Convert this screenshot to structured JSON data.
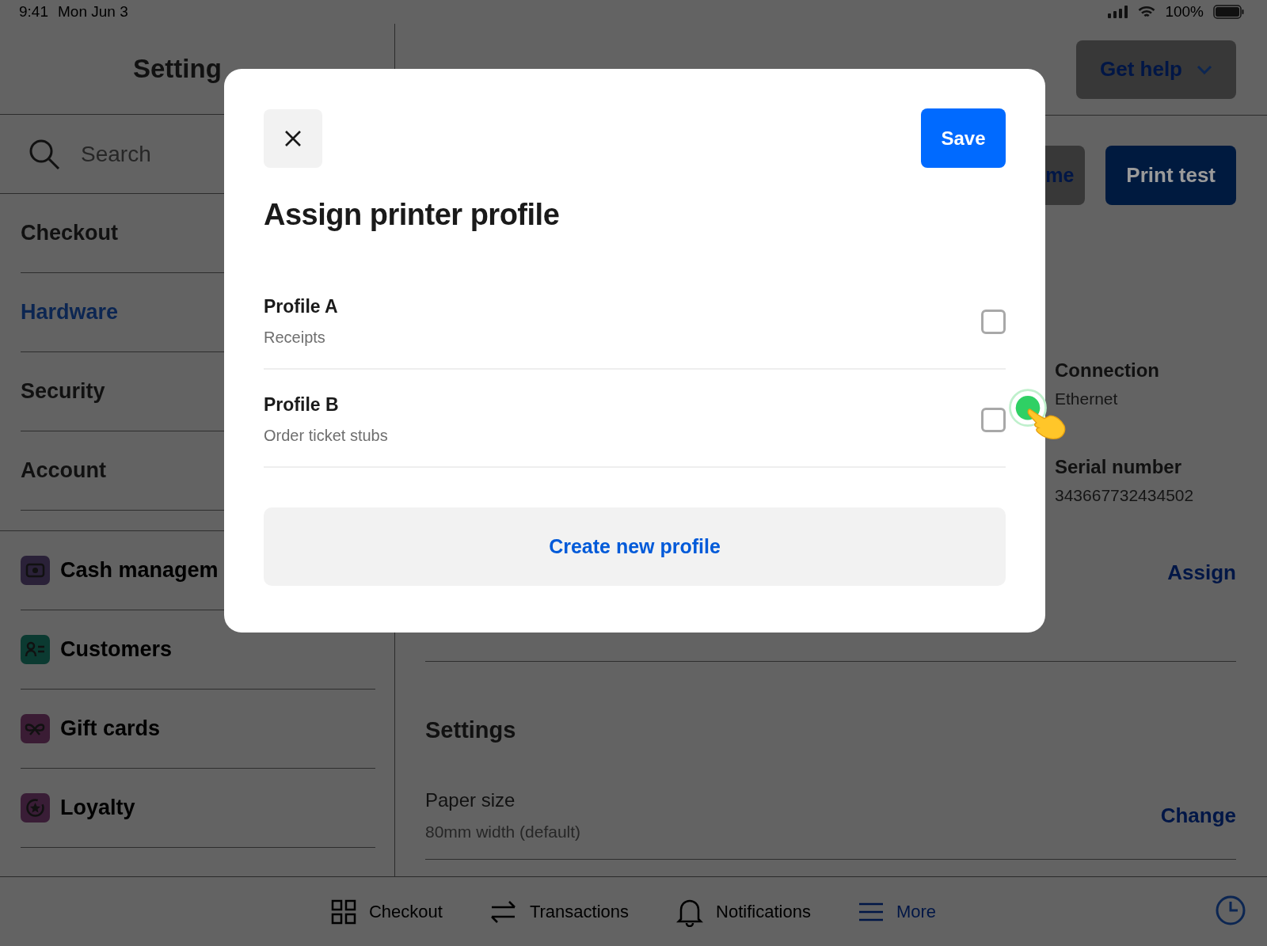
{
  "status_bar": {
    "time": "9:41",
    "date": "Mon Jun 3",
    "battery": "100%"
  },
  "sidebar": {
    "title": "Setting",
    "search": {
      "placeholder": "Search"
    },
    "sections": [
      {
        "label": "Checkout",
        "selected": false
      },
      {
        "label": "Hardware",
        "selected": true
      },
      {
        "label": "Security",
        "selected": false
      },
      {
        "label": "Account",
        "selected": false
      }
    ],
    "apps": [
      {
        "label": "Cash managem",
        "kind": "cash",
        "color": "#2a2138"
      },
      {
        "label": "Customers",
        "kind": "customers",
        "color": "#0b3a31"
      },
      {
        "label": "Gift cards",
        "kind": "gift",
        "color": "#3a1c34"
      },
      {
        "label": "Loyalty",
        "kind": "loyalty",
        "color": "#391d36"
      }
    ]
  },
  "content": {
    "help_button": "Get help",
    "buttons": [
      "me",
      "Print test"
    ],
    "details": [
      {
        "label": "Connection",
        "value": "Ethernet"
      },
      {
        "label": "Serial number",
        "value": "343667732434502"
      }
    ],
    "assign_link": "Assign",
    "settings_heading": "Settings",
    "paper": {
      "label": "Paper size",
      "value": "80mm width (default)",
      "action": "Change"
    }
  },
  "modal": {
    "title": "Assign printer profile",
    "save": "Save",
    "profiles": [
      {
        "name": "Profile A",
        "description": "Receipts",
        "checked": false
      },
      {
        "name": "Profile B",
        "description": "Order ticket stubs",
        "checked": false
      }
    ],
    "create": "Create new profile"
  },
  "tab_bar": [
    {
      "label": "Checkout",
      "kind": "grid",
      "selected": false
    },
    {
      "label": "Transactions",
      "kind": "arrows",
      "selected": false
    },
    {
      "label": "Notifications",
      "kind": "bell",
      "selected": false
    },
    {
      "label": "More",
      "kind": "menu",
      "selected": true
    }
  ]
}
